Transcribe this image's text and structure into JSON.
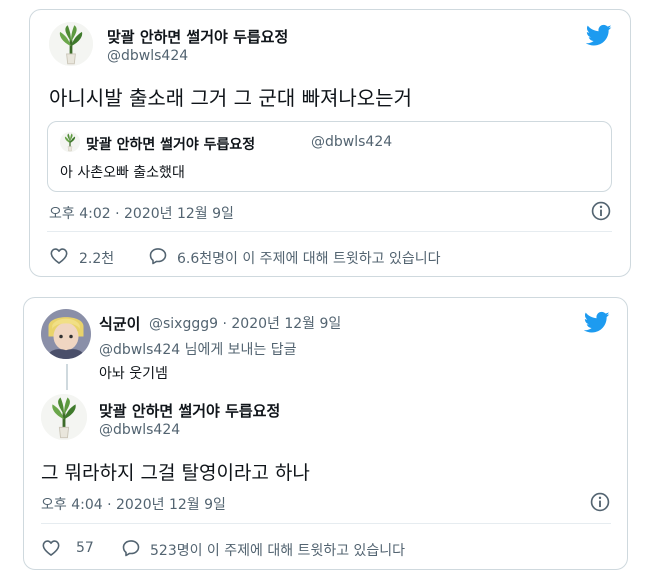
{
  "colors": {
    "twitter_blue": "#1d9bf0",
    "border": "#cfd9de",
    "muted": "#536471",
    "text": "#0f1419"
  },
  "tweet1": {
    "author_name": "맞괄 안하면 썰거야 두릅요정",
    "author_handle": "@dbwls424",
    "text": "아니시발 출소래 그거 그 군대 빠져나오는거",
    "quote": {
      "author_name": "맞괄 안하면 썰거야 두릅요정",
      "author_handle": "@dbwls424",
      "text": "아 사촌오빠 출소했대"
    },
    "timestamp": "오후 4:02 · 2020년 12월 9일",
    "likes": "2.2천",
    "talking": "6.6천명이 이 주제에 대해 트윗하고 있습니다"
  },
  "tweet2": {
    "reply": {
      "author_name": "식균이",
      "author_handle": "@sixggg9 · 2020년 12월 9일",
      "replying_to": "@dbwls424 님에게 보내는 답글",
      "text": "아놔 웃기넴"
    },
    "main": {
      "author_name": "맞괄 안하면 썰거야 두릅요정",
      "author_handle": "@dbwls424",
      "text": "그 뭐라하지 그걸 탈영이라고 하나"
    },
    "timestamp": "오후 4:04 · 2020년 12월 9일",
    "likes": "57",
    "talking": "523명이 이 주제에 대해 트윗하고 있습니다"
  },
  "icons": {
    "bird": "twitter-bird-icon",
    "info": "info-icon",
    "heart": "heart-icon",
    "bubble": "speech-bubble-icon"
  }
}
